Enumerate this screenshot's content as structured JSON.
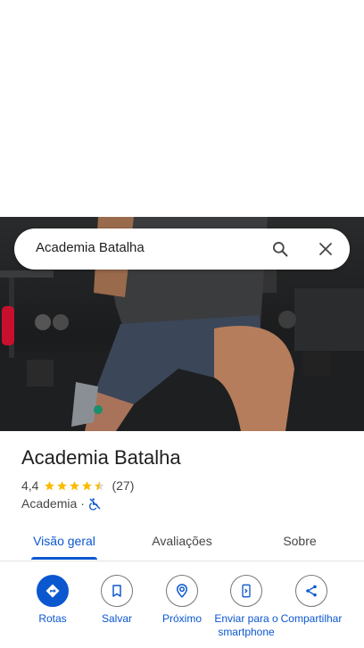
{
  "search": {
    "query": "Academia Batalha"
  },
  "icons": {
    "search": "search-icon",
    "close": "close-icon",
    "star": "star-icon",
    "wheelchair_not_accessible": "wheelchair-not-accessible-icon",
    "directions": "directions-icon",
    "save": "bookmark-icon",
    "nearby": "nearby-icon",
    "send": "send-to-phone-icon",
    "share": "share-icon"
  },
  "place": {
    "name": "Academia Batalha",
    "rating": "4,4",
    "rating_numeric": 4.4,
    "review_count": "(27)",
    "category": "Academia",
    "separator": "·"
  },
  "tabs": [
    {
      "label": "Visão geral",
      "active": true
    },
    {
      "label": "Avaliações",
      "active": false
    },
    {
      "label": "Sobre",
      "active": false
    }
  ],
  "actions": [
    {
      "label": "Rotas"
    },
    {
      "label": "Salvar"
    },
    {
      "label": "Próximo"
    },
    {
      "label": "Enviar para o smartphone"
    },
    {
      "label": "Compartilhar"
    }
  ],
  "colors": {
    "accent": "#0b57d0",
    "star": "#fbbc04",
    "text_secondary": "#444746"
  }
}
